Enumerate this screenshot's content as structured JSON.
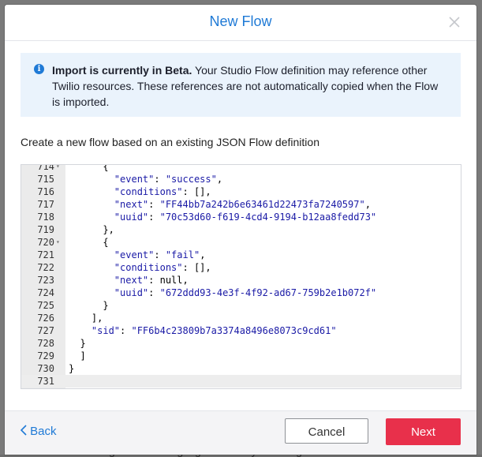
{
  "background": {
    "snippet_bottom": "creating and tweaking logic on the fly. Leverage"
  },
  "dialog": {
    "title": "New Flow",
    "close_icon": "close-icon"
  },
  "beta_notice": {
    "icon": "info-icon",
    "bold": "Import is currently in Beta.",
    "text": " Your Studio Flow definition may reference other Twilio resources. These references are not automatically copied when the Flow is imported."
  },
  "description": "Create a new flow based on an existing JSON Flow definition",
  "editor": {
    "lines": [
      {
        "num": "714",
        "fold": true,
        "code": "      {"
      },
      {
        "num": "715",
        "fold": false,
        "code": "        \"event\": \"success\","
      },
      {
        "num": "716",
        "fold": false,
        "code": "        \"conditions\": [],"
      },
      {
        "num": "717",
        "fold": false,
        "code": "        \"next\": \"FF44bb7a242b6e63461d22473fa7240597\","
      },
      {
        "num": "718",
        "fold": false,
        "code": "        \"uuid\": \"70c53d60-f619-4cd4-9194-b12aa8fedd73\""
      },
      {
        "num": "719",
        "fold": false,
        "code": "      },"
      },
      {
        "num": "720",
        "fold": true,
        "code": "      {"
      },
      {
        "num": "721",
        "fold": false,
        "code": "        \"event\": \"fail\","
      },
      {
        "num": "722",
        "fold": false,
        "code": "        \"conditions\": [],"
      },
      {
        "num": "723",
        "fold": false,
        "code": "        \"next\": null,"
      },
      {
        "num": "724",
        "fold": false,
        "code": "        \"uuid\": \"672ddd93-4e3f-4f92-ad67-759b2e1b072f\""
      },
      {
        "num": "725",
        "fold": false,
        "code": "      }"
      },
      {
        "num": "726",
        "fold": false,
        "code": "    ],"
      },
      {
        "num": "727",
        "fold": false,
        "code": "    \"sid\": \"FF6b4c23809b7a3374a8496e8073c9cd61\""
      },
      {
        "num": "728",
        "fold": false,
        "code": "  }"
      },
      {
        "num": "729",
        "fold": false,
        "code": "  ]"
      },
      {
        "num": "730",
        "fold": false,
        "code": "}"
      },
      {
        "num": "731",
        "fold": false,
        "code": ""
      }
    ],
    "active_line": "731"
  },
  "footer": {
    "back_label": "Back",
    "back_icon": "chevron-left-icon",
    "cancel_label": "Cancel",
    "next_label": "Next"
  },
  "colors": {
    "accent": "#1f7ad6",
    "primary_button": "#e8304b",
    "notice_bg": "#eaf3fc"
  }
}
